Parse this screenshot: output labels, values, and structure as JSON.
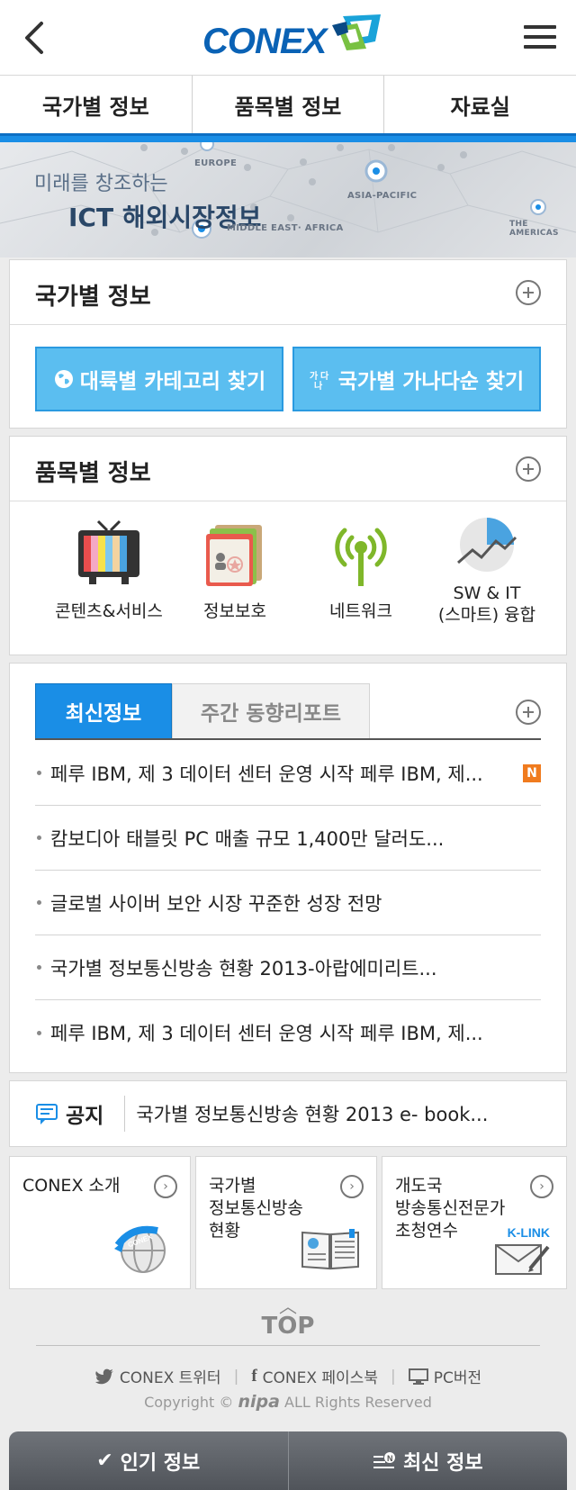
{
  "header": {
    "logo": "CONEX",
    "back_icon": "chevron-left-icon",
    "menu_icon": "hamburger-icon"
  },
  "top_tabs": [
    "국가별 정보",
    "품목별 정보",
    "자료실"
  ],
  "banner": {
    "subtitle": "미래를 창조하는",
    "title": "ICT 해외시장정보",
    "regions": [
      "EUROPE",
      "ASIA-PACIFIC",
      "MIDDLE EAST· AFRICA",
      "THE AMERICAS"
    ]
  },
  "country_info": {
    "title": "국가별 정보",
    "continent_button": "대륙별 카테고리 찾기",
    "alphabet_button": "국가별 가나다순 찾기"
  },
  "item_info": {
    "title": "품목별 정보",
    "categories": [
      {
        "label": "콘텐츠&서비스",
        "icon": "tv-icon"
      },
      {
        "label": "정보보호",
        "icon": "security-folder-icon"
      },
      {
        "label": "네트워크",
        "icon": "antenna-icon"
      },
      {
        "label": "SW & IT\n(스마트) 융합",
        "icon": "pie-chart-icon"
      }
    ]
  },
  "news": {
    "tab_active": "최신정보",
    "tab_inactive": "주간 동향리포트",
    "items": [
      {
        "text": "페루 IBM, 제 3 데이터 센터 운영 시작 페루 IBM, 제...",
        "badge": "N"
      },
      {
        "text": "캄보디아 태블릿 PC 매출 규모 1,400만 달러도..."
      },
      {
        "text": "글로벌 사이버 보안 시장 꾸준한 성장 전망"
      },
      {
        "text": "국가별 정보통신방송 현황 2013-아랍에미리트..."
      },
      {
        "text": "페루 IBM, 제 3 데이터 센터 운영 시작 페루 IBM, 제..."
      }
    ]
  },
  "notice": {
    "label": "공지",
    "text": "국가별 정보통신방송 현황 2013 e- book..."
  },
  "boxes": [
    {
      "label": "CONEX 소개",
      "icon": "globe-icon"
    },
    {
      "label": "국가별\n정보통신방송\n현황",
      "icon": "book-icon"
    },
    {
      "label": "개도국\n방송통신전문가\n초청연수",
      "icon": "envelope-icon",
      "badge": "K-LINK"
    }
  ],
  "footer": {
    "top_label": "TOP",
    "twitter": "CONEX 트위터",
    "facebook": "CONEX 페이스북",
    "pc": "PC버전",
    "copyright_prefix": "Copyright ©",
    "copyright_brand": "nipa",
    "copyright_suffix": "ALL Rights Reserved"
  },
  "bottom_bar": {
    "popular": "인기 정보",
    "latest": "최신 정보"
  },
  "colors": {
    "accent": "#1a8ee6",
    "button": "#5bbef0",
    "new_badge": "#f07b1e",
    "logo": "#0a62b5"
  }
}
